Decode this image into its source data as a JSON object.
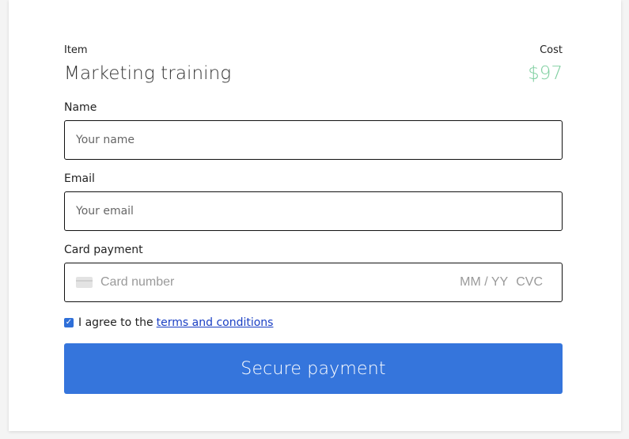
{
  "header": {
    "item_label": "Item",
    "cost_label": "Cost"
  },
  "product": {
    "name": "Marketing training",
    "price": "$97"
  },
  "form": {
    "name": {
      "label": "Name",
      "placeholder": "Your name"
    },
    "email": {
      "label": "Email",
      "placeholder": "Your email"
    },
    "card": {
      "label": "Card payment",
      "number_placeholder": "Card number",
      "expiry_placeholder": "MM / YY",
      "cvc_placeholder": "CVC"
    },
    "agree": {
      "text": "I agree to the",
      "link_text": "terms and conditions",
      "checked": true
    },
    "submit_label": "Secure payment"
  },
  "colors": {
    "accent": "#3575dc",
    "price": "#7fcfa0",
    "link": "#1a3fc4"
  },
  "icons": {
    "card": "credit-card-icon",
    "check": "checkmark-icon"
  }
}
